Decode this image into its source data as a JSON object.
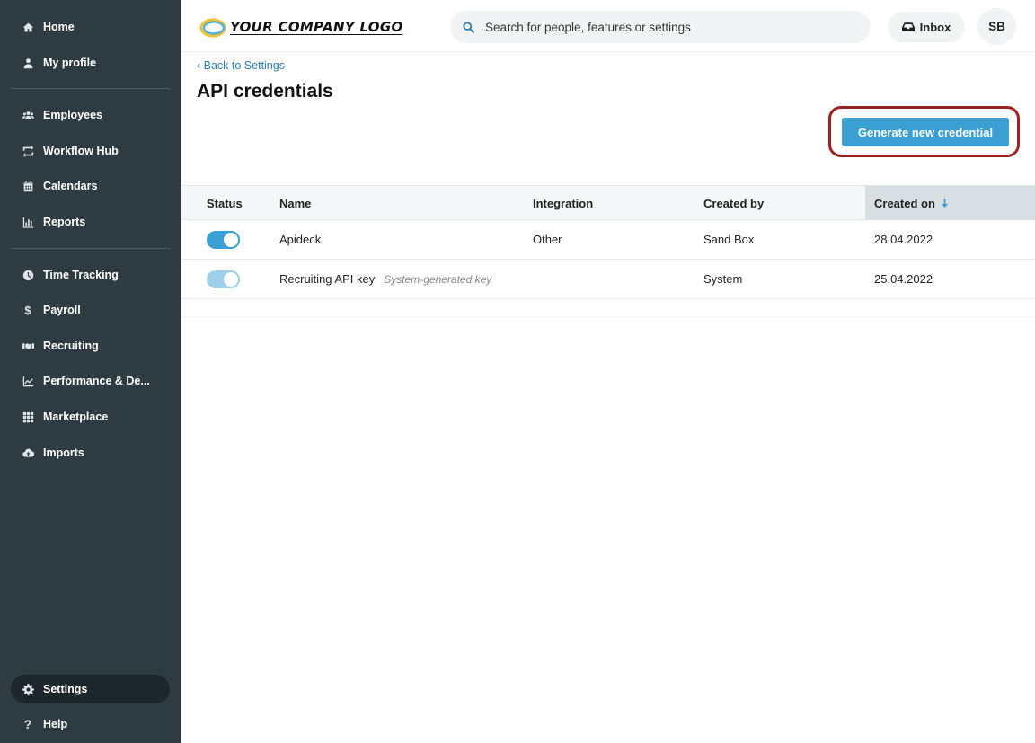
{
  "sidebar": {
    "items": [
      {
        "label": "Home",
        "icon": "home-icon"
      },
      {
        "label": "My profile",
        "icon": "person-icon"
      },
      {
        "label": "Employees",
        "icon": "people-icon"
      },
      {
        "label": "Workflow Hub",
        "icon": "workflow-icon"
      },
      {
        "label": "Calendars",
        "icon": "calendar-icon"
      },
      {
        "label": "Reports",
        "icon": "chart-icon"
      },
      {
        "label": "Time Tracking",
        "icon": "clock-icon"
      },
      {
        "label": "Payroll",
        "icon": "dollar-icon"
      },
      {
        "label": "Recruiting",
        "icon": "handshake-icon"
      },
      {
        "label": "Performance & De...",
        "icon": "trend-icon"
      },
      {
        "label": "Marketplace",
        "icon": "grid-icon"
      },
      {
        "label": "Imports",
        "icon": "cloud-upload-icon"
      }
    ],
    "settings_label": "Settings",
    "help_label": "Help"
  },
  "header": {
    "logo_text": "YOUR COMPANY LOGO",
    "search_placeholder": "Search for people, features or settings",
    "inbox_label": "Inbox",
    "avatar_initials": "SB"
  },
  "main": {
    "back_link": "Back to Settings",
    "title": "API credentials",
    "generate_button": "Generate new credential"
  },
  "table": {
    "columns": [
      "Status",
      "Name",
      "Integration",
      "Created by",
      "Created on"
    ],
    "sorted_column": "Created on",
    "rows": [
      {
        "status": "on",
        "name": "Apideck",
        "tag": "",
        "integration": "Other",
        "created_by": "Sand Box",
        "created_on": "28.04.2022"
      },
      {
        "status": "on-disabled",
        "name": "Recruiting API key",
        "tag": "System-generated key",
        "integration": "",
        "created_by": "System",
        "created_on": "25.04.2022"
      }
    ]
  },
  "colors": {
    "sidebar_bg": "#2e3c41",
    "accent": "#3b9fd4",
    "highlight": "#9a2221"
  }
}
